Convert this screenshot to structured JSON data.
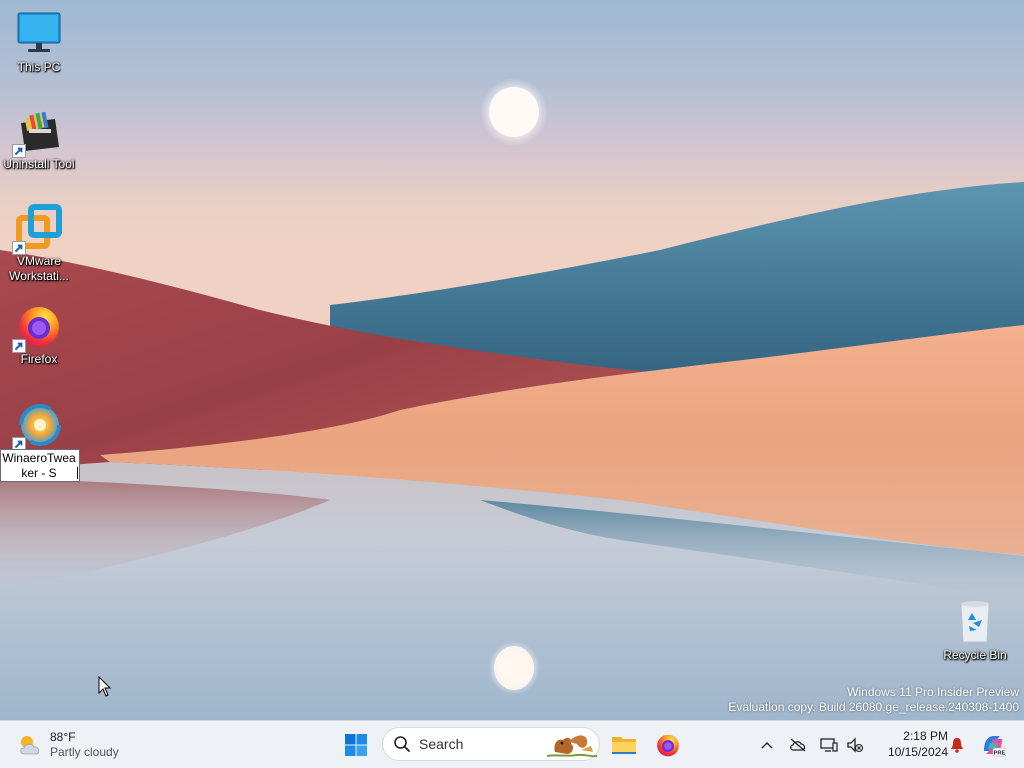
{
  "desktop": {
    "icons": [
      {
        "id": "this-pc",
        "label": "This PC"
      },
      {
        "id": "uninstall-tool",
        "label": "Uninstall Tool"
      },
      {
        "id": "vmware",
        "label": "VMware Workstati..."
      },
      {
        "id": "firefox",
        "label": "Firefox"
      },
      {
        "id": "winaero",
        "label": "WinaeroTwea ker - S"
      },
      {
        "id": "recycle-bin",
        "label": "Recycle Bin"
      }
    ],
    "rename_value": "WinaeroTwea ker - S"
  },
  "watermark": {
    "line1": "Windows 11 Pro Insider Preview",
    "line2": "Evaluation copy. Build 26080.ge_release.240308-1400"
  },
  "taskbar": {
    "weather": {
      "temperature": "88°F",
      "condition": "Partly cloudy",
      "icon": "partly-cloudy-icon"
    },
    "search": {
      "placeholder": "Search"
    },
    "pinned": [
      {
        "name": "Start",
        "icon": "windows-logo-icon"
      },
      {
        "name": "File Explorer",
        "icon": "folder-icon"
      },
      {
        "name": "Firefox",
        "icon": "firefox-icon"
      }
    ],
    "tray": {
      "icons": [
        "chevron-up-icon",
        "onedrive-offline-icon",
        "network-icon",
        "volume-muted-icon",
        "notification-bell-icon",
        "copilot-icon"
      ],
      "copilot_badge": "PRE"
    },
    "clock": {
      "time": "2:18 PM",
      "date": "10/15/2024"
    }
  },
  "colors": {
    "taskbar_bg": "#eef1f6",
    "accent": "#0078d4",
    "bell": "#c42b1c"
  }
}
